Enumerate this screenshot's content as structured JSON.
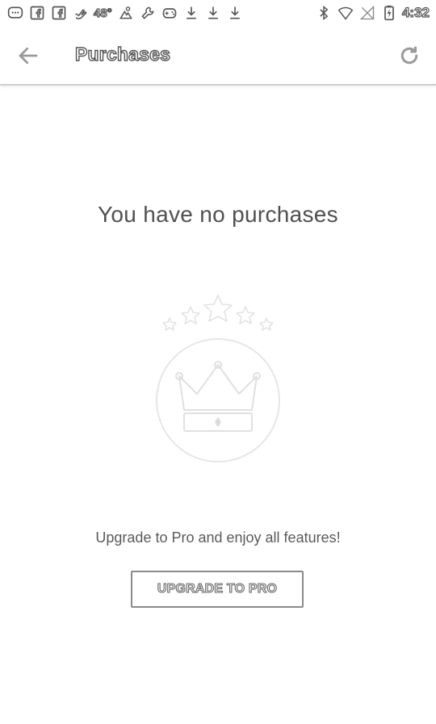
{
  "status_bar": {
    "left_icons": [
      "chat-bubble-icon",
      "facebook-icon",
      "facebook-icon",
      "hand-icon",
      "temperature-text",
      "weather-icon",
      "wrench-icon",
      "gamepad-icon",
      "download-icon",
      "download-icon",
      "download-icon"
    ],
    "temperature": "48°",
    "right_icons": [
      "bluetooth-icon",
      "wifi-icon",
      "no-signal-icon",
      "battery-icon"
    ],
    "time": "4:32"
  },
  "toolbar": {
    "back_icon": "arrow-left-icon",
    "title": "Purchases",
    "refresh_icon": "refresh-icon"
  },
  "main": {
    "empty_title": "You have no purchases",
    "illustration": "crown-with-stars-icon",
    "upgrade_text": "Upgrade to Pro and enjoy all features!",
    "upgrade_button_label": "UPGRADE TO PRO"
  },
  "colors": {
    "background": "#ffffff",
    "text": "#505050",
    "border": "#8a8a8a",
    "illustration": "#e6e6e6"
  }
}
